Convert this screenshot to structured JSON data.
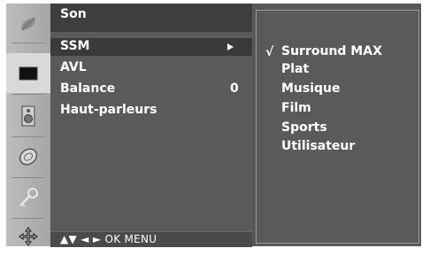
{
  "menu": {
    "title": "Son",
    "items": [
      {
        "label": "SSM",
        "value": ""
      },
      {
        "label": "AVL",
        "value": ""
      },
      {
        "label": "Balance",
        "value": "0"
      },
      {
        "label": "Haut-parleurs",
        "value": ""
      }
    ],
    "nav_hint": "▲▼ ◄ ► OK  MENU"
  },
  "submenu": {
    "check": "√",
    "items": [
      "Surround MAX",
      "Plat",
      "Musique",
      "Film",
      "Sports",
      "Utilisateur"
    ]
  },
  "icons": [
    "picture-icon",
    "screen-icon",
    "speaker-icon",
    "time-icon",
    "key-icon",
    "setup-icon"
  ],
  "colors": {
    "panel": "#5a5a5a",
    "highlight": "#3a3a3a",
    "strip": "#b0b0b0",
    "active": "#d9d9d9"
  }
}
